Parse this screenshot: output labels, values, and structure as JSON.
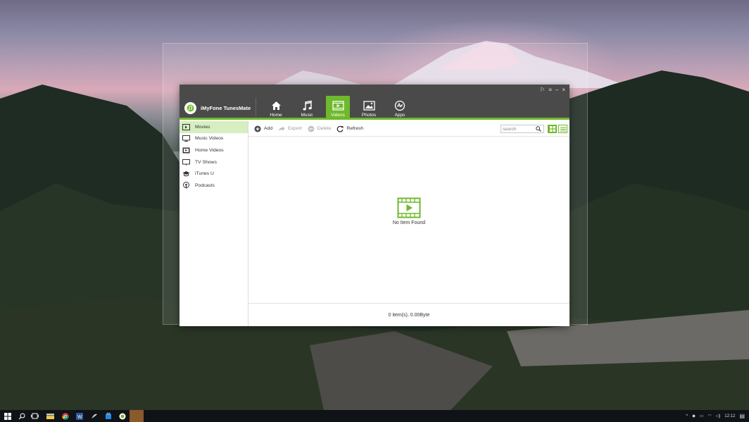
{
  "app": {
    "name": "iMyFone TunesMate",
    "window_controls": [
      "⚐",
      "≡",
      "–",
      "×"
    ]
  },
  "nav_tabs": [
    {
      "label": "Home",
      "icon": "home-icon",
      "active": false
    },
    {
      "label": "Music",
      "icon": "music-note-icon",
      "active": false
    },
    {
      "label": "Videos",
      "icon": "video-icon",
      "active": true
    },
    {
      "label": "Photos",
      "icon": "photo-icon",
      "active": false
    },
    {
      "label": "Apps",
      "icon": "apps-icon",
      "active": false
    }
  ],
  "sidebar": {
    "items": [
      {
        "label": "Movies",
        "icon": "movie-icon",
        "active": true
      },
      {
        "label": "Music Videos",
        "icon": "music-video-icon",
        "active": false
      },
      {
        "label": "Home Videos",
        "icon": "home-video-icon",
        "active": false
      },
      {
        "label": "TV Shows",
        "icon": "tv-icon",
        "active": false
      },
      {
        "label": "iTunes U",
        "icon": "graduation-cap-icon",
        "active": false
      },
      {
        "label": "Podcasts",
        "icon": "podcast-icon",
        "active": false
      }
    ]
  },
  "toolbar": {
    "add_label": "Add",
    "export_label": "Export",
    "delete_label": "Delete",
    "refresh_label": "Refresh",
    "search_placeholder": "search"
  },
  "empty_state": {
    "icon": "video-icon",
    "text": "No Item Found"
  },
  "status": {
    "summary": "0 item(s), 0.00Byte"
  },
  "taskbar": {
    "icons": [
      "windows-start-icon",
      "search-icon",
      "task-view-icon",
      "file-explorer-icon",
      "chrome-icon",
      "word-icon",
      "app-icon",
      "store-icon",
      "tunesmate-icon",
      "app-icon-brown"
    ],
    "clock": "12:12"
  },
  "colors": {
    "accent": "#6fb92c",
    "titlebar": "#4a4a4a",
    "sidebar_active": "#d6eec0"
  }
}
